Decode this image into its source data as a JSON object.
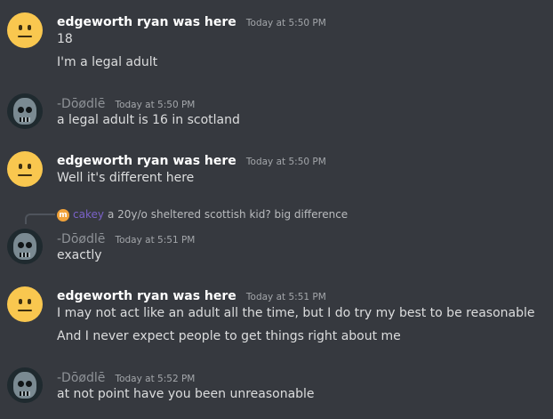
{
  "messages": [
    {
      "username": "edgeworth ryan was here",
      "timestamp": "Today at 5:50 PM",
      "lines": [
        "18",
        "I'm a legal adult"
      ]
    },
    {
      "username": "-Dōødlē",
      "timestamp": "Today at 5:50 PM",
      "lines": [
        "a legal adult is 16 in scotland"
      ]
    },
    {
      "username": "edgeworth ryan was here",
      "timestamp": "Today at 5:50 PM",
      "lines": [
        "Well it's different here"
      ]
    },
    {
      "reply": {
        "avatar_letter": "m",
        "username": "cakey",
        "text": "a 20y/o sheltered scottish kid? big difference"
      },
      "username": "-Dōødlē",
      "timestamp": "Today at 5:51 PM",
      "lines": [
        "exactly"
      ]
    },
    {
      "username": "edgeworth ryan was here",
      "timestamp": "Today at 5:51 PM",
      "lines": [
        "I may not act like an adult all the time, but I do try my best to be reasonable",
        "And I never expect people to get things right about me"
      ]
    },
    {
      "username": "-Dōødlē",
      "timestamp": "Today at 5:52 PM",
      "lines": [
        "at not point have you been unreasonable"
      ]
    }
  ],
  "icons": {
    "emoji_avatar": "neutral-face-icon",
    "skull_avatar": "skull-icon"
  },
  "colors": {
    "background": "#36393f",
    "username": "#ffffff",
    "timestamp": "#a3a6aa",
    "reply_username": "#7b62c9"
  }
}
